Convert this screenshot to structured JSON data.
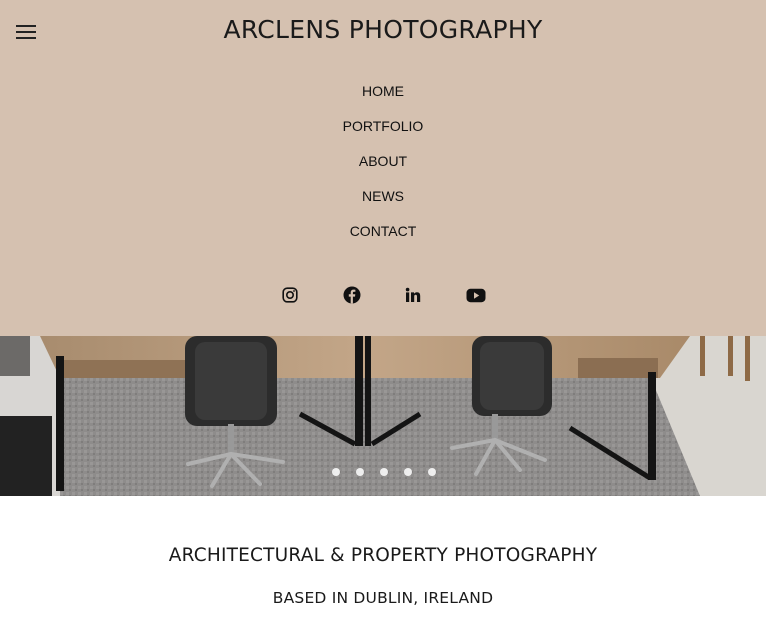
{
  "header": {
    "title": "ARCLENS PHOTOGRAPHY",
    "background": "#d5c1b0",
    "menu_icon": "hamburger-menu-icon"
  },
  "nav": {
    "items": [
      {
        "label": "HOME"
      },
      {
        "label": "PORTFOLIO"
      },
      {
        "label": "ABOUT"
      },
      {
        "label": "NEWS"
      },
      {
        "label": "CONTACT"
      }
    ]
  },
  "socials": [
    {
      "icon": "instagram-icon"
    },
    {
      "icon": "facebook-icon"
    },
    {
      "icon": "linkedin-icon"
    },
    {
      "icon": "youtube-icon"
    }
  ],
  "hero": {
    "image": "office-desks-chairs-photo",
    "slides_count": 5,
    "active_slide": 1
  },
  "intro": {
    "heading": "ARCHITECTURAL & PROPERTY PHOTOGRAPHY",
    "subheading": "BASED IN DUBLIN, IRELAND"
  }
}
